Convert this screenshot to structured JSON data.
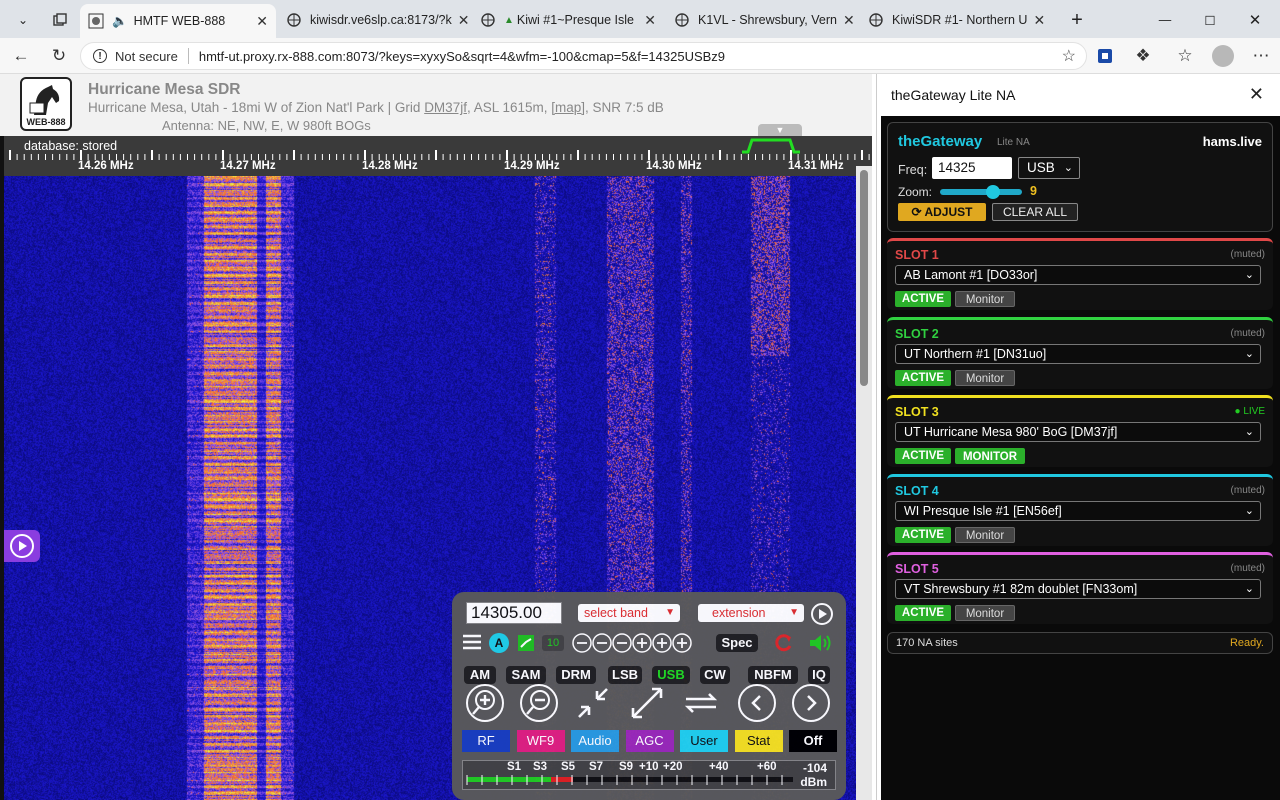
{
  "browser": {
    "tabs": [
      {
        "title": "HMTF WEB-888",
        "active": true
      },
      {
        "title": "kiwisdr.ve6slp.ca:8173/?k",
        "active": false
      },
      {
        "title": "Kiwi #1~Presque Isle",
        "active": false
      },
      {
        "title": "K1VL - Shrewsbury, Vern",
        "active": false
      },
      {
        "title": "KiwiSDR #1- Northern U",
        "active": false
      }
    ],
    "not_secure": "Not secure",
    "url": "hmtf-ut.proxy.rx-888.com:8073/?keys=xyxySo&sqrt=4&wfm=-100&cmap=5&f=14325USBz9"
  },
  "sdr": {
    "logo_text": "WEB-888",
    "name": "Hurricane Mesa SDR",
    "location_prefix": "Hurricane Mesa, Utah - 18mi W of Zion Nat'l Park | Grid ",
    "grid": "DM37jf",
    "location_mid": ", ASL 1615m, ",
    "map_link": "[map]",
    "location_suffix": ", SNR 7:5 dB",
    "antenna": "Antenna: NE, NW, E, W 980ft BOGs",
    "db_status": "database: stored",
    "freq_ticks": [
      "14.26 MHz",
      "14.27 MHz",
      "14.28 MHz",
      "14.29 MHz",
      "14.30 MHz",
      "14.31 MHz"
    ],
    "controls": {
      "freq": "14305.00",
      "select_band": "select band",
      "extension": "extension",
      "step_count": "10",
      "spec": "Spec",
      "modes": [
        "AM",
        "SAM",
        "DRM",
        "LSB",
        "USB",
        "CW",
        "NBFM",
        "IQ"
      ],
      "active_mode": "USB",
      "color_buttons": [
        {
          "label": "RF",
          "color": "#1a3fbf"
        },
        {
          "label": "WF9",
          "color": "#e02080"
        },
        {
          "label": "Audio",
          "color": "#2a9be0"
        },
        {
          "label": "AGC",
          "color": "#9a2ab8"
        },
        {
          "label": "User",
          "color": "#22d0ee"
        },
        {
          "label": "Stat",
          "color": "#f5e020"
        },
        {
          "label": "Off",
          "color": "#000000"
        }
      ],
      "smeter_labels": [
        "S1",
        "S3",
        "S5",
        "S7",
        "S9",
        "+10",
        "+20",
        "+40",
        "+60"
      ],
      "smeter_value": "-104",
      "smeter_unit": "dBm"
    }
  },
  "panel": {
    "title": "theGateway Lite NA",
    "brand": "theGateway",
    "brand_sub": "Lite NA",
    "site": "hams.live",
    "freq_label": "Freq:",
    "freq": "14325",
    "mode": "USB",
    "zoom_label": "Zoom:",
    "zoom": "9",
    "adjust": "ADJUST",
    "clear_all": "CLEAR ALL",
    "slots": [
      {
        "label": "SLOT 1",
        "status": "(muted)",
        "sdr": "AB Lamont #1 [DO33or]",
        "color": "#e04848",
        "active": "ACTIVE",
        "monitor": "Monitor",
        "live": false
      },
      {
        "label": "SLOT 2",
        "status": "(muted)",
        "sdr": "UT Northern #1 [DN31uo]",
        "color": "#30d040",
        "active": "ACTIVE",
        "monitor": "Monitor",
        "live": false
      },
      {
        "label": "SLOT 3",
        "status": "● LIVE",
        "sdr": "UT Hurricane Mesa 980' BoG [DM37jf]",
        "color": "#f0e020",
        "active": "ACTIVE",
        "monitor": "MONITOR",
        "live": true
      },
      {
        "label": "SLOT 4",
        "status": "(muted)",
        "sdr": "WI Presque Isle #1 [EN56ef]",
        "color": "#20c8e0",
        "active": "ACTIVE",
        "monitor": "Monitor",
        "live": false
      },
      {
        "label": "SLOT 5",
        "status": "(muted)",
        "sdr": "VT Shrewsbury #1 82m doublet [FN33om]",
        "color": "#e060e0",
        "active": "ACTIVE",
        "monitor": "Monitor",
        "live": false
      }
    ],
    "site_count": "170 NA sites",
    "status": "Ready."
  }
}
